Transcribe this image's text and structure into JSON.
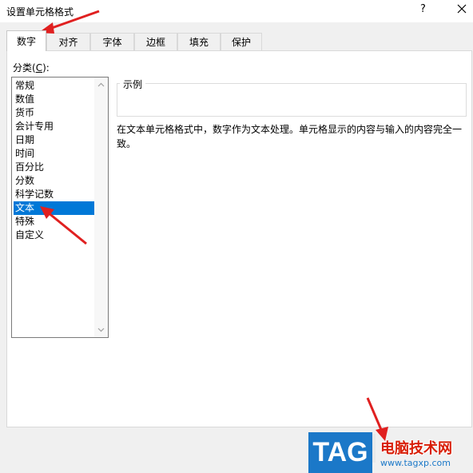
{
  "window": {
    "title": "设置单元格格式",
    "help_label": "?",
    "close_label": "×"
  },
  "tabs": [
    {
      "label": "数字"
    },
    {
      "label": "对齐"
    },
    {
      "label": "字体"
    },
    {
      "label": "边框"
    },
    {
      "label": "填充"
    },
    {
      "label": "保护"
    }
  ],
  "category": {
    "label_prefix": "分类(",
    "label_hotkey": "C",
    "label_suffix": "):",
    "items": [
      "常规",
      "数值",
      "货币",
      "会计专用",
      "日期",
      "时间",
      "百分比",
      "分数",
      "科学记数",
      "文本",
      "特殊",
      "自定义"
    ],
    "selected": "文本"
  },
  "sample": {
    "legend": "示例"
  },
  "description": "在文本单元格格式中，数字作为文本处理。单元格显示的内容与输入的内容完全一致。",
  "watermark": {
    "tag": "TAG",
    "site": "电脑技术网",
    "url": "www.tagxp.com"
  },
  "colors": {
    "selection": "#0078d7",
    "annotation_arrow": "#e02020",
    "watermark_blue": "#1b78c8",
    "watermark_red": "#d81e06"
  }
}
